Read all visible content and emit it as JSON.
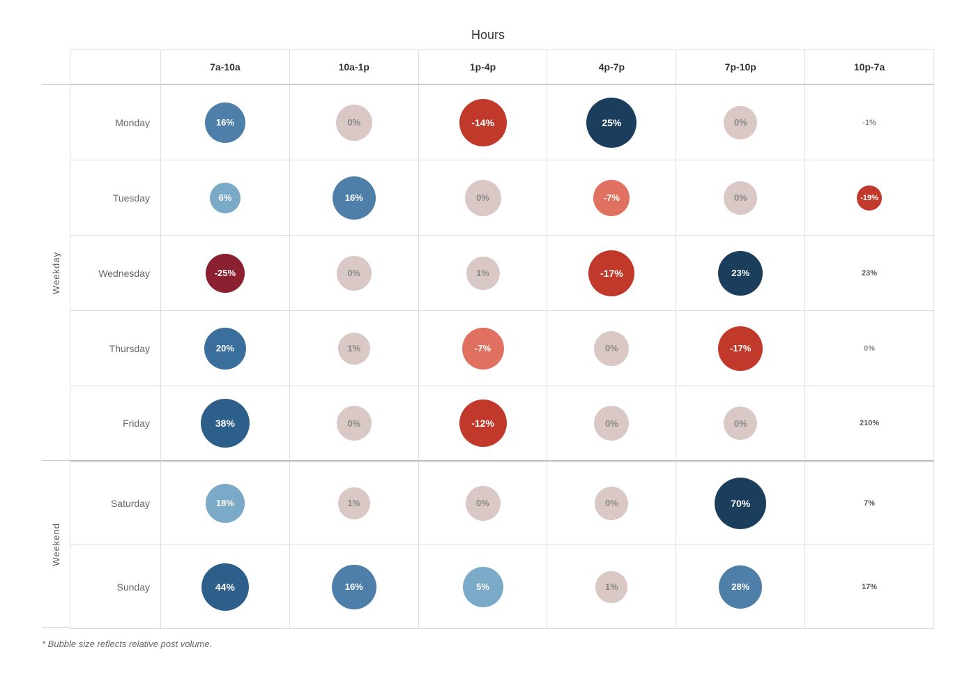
{
  "title": "Hours",
  "columns": [
    "",
    "7a-10a",
    "10a-1p",
    "1p-4p",
    "4p-7p",
    "7p-10p",
    "10p-7a"
  ],
  "groups": [
    {
      "name": "Weekday",
      "rows": [
        {
          "day": "Monday",
          "cells": [
            {
              "value": "16%",
              "size": 58,
              "color": "#4e7fa8",
              "textColor": "#fff"
            },
            {
              "value": "0%",
              "size": 52,
              "color": "#d9c8c5",
              "textColor": "#888"
            },
            {
              "value": "-14%",
              "size": 68,
              "color": "#c0392b",
              "textColor": "#fff"
            },
            {
              "value": "25%",
              "size": 72,
              "color": "#1a3e5c",
              "textColor": "#fff"
            },
            {
              "value": "0%",
              "size": 48,
              "color": "#d9c8c5",
              "textColor": "#888"
            },
            {
              "value": "-1%",
              "size": 30,
              "color": "transparent",
              "textColor": "#888"
            }
          ]
        },
        {
          "day": "Tuesday",
          "cells": [
            {
              "value": "6%",
              "size": 44,
              "color": "#7aaac8",
              "textColor": "#fff"
            },
            {
              "value": "16%",
              "size": 62,
              "color": "#4e7fa8",
              "textColor": "#fff"
            },
            {
              "value": "0%",
              "size": 52,
              "color": "#d9c8c5",
              "textColor": "#888"
            },
            {
              "value": "-7%",
              "size": 52,
              "color": "#e07060",
              "textColor": "#fff"
            },
            {
              "value": "0%",
              "size": 48,
              "color": "#d9c8c5",
              "textColor": "#888"
            },
            {
              "value": "-19%",
              "size": 36,
              "color": "#c0392b",
              "textColor": "#fff"
            }
          ]
        },
        {
          "day": "Wednesday",
          "cells": [
            {
              "value": "-25%",
              "size": 56,
              "color": "#8b2030",
              "textColor": "#fff"
            },
            {
              "value": "0%",
              "size": 50,
              "color": "#d9c8c5",
              "textColor": "#888"
            },
            {
              "value": "1%",
              "size": 48,
              "color": "#d9c8c5",
              "textColor": "#888"
            },
            {
              "value": "-17%",
              "size": 66,
              "color": "#c0392b",
              "textColor": "#fff"
            },
            {
              "value": "23%",
              "size": 64,
              "color": "#1a3e5c",
              "textColor": "#fff"
            },
            {
              "value": "23%",
              "size": 34,
              "color": "transparent",
              "textColor": "#555"
            }
          ]
        },
        {
          "day": "Thursday",
          "cells": [
            {
              "value": "20%",
              "size": 60,
              "color": "#3a6e9c",
              "textColor": "#fff"
            },
            {
              "value": "1%",
              "size": 46,
              "color": "#d9c8c5",
              "textColor": "#888"
            },
            {
              "value": "-7%",
              "size": 60,
              "color": "#e07060",
              "textColor": "#fff"
            },
            {
              "value": "0%",
              "size": 50,
              "color": "#d9c8c5",
              "textColor": "#888"
            },
            {
              "value": "-17%",
              "size": 64,
              "color": "#c0392b",
              "textColor": "#fff"
            },
            {
              "value": "0%",
              "size": 32,
              "color": "transparent",
              "textColor": "#888"
            }
          ]
        },
        {
          "day": "Friday",
          "cells": [
            {
              "value": "38%",
              "size": 70,
              "color": "#2c5f8a",
              "textColor": "#fff"
            },
            {
              "value": "0%",
              "size": 50,
              "color": "#d9c8c5",
              "textColor": "#888"
            },
            {
              "value": "-12%",
              "size": 68,
              "color": "#c0392b",
              "textColor": "#fff"
            },
            {
              "value": "0%",
              "size": 50,
              "color": "#d9c8c5",
              "textColor": "#888"
            },
            {
              "value": "0%",
              "size": 48,
              "color": "#d9c8c5",
              "textColor": "#888"
            },
            {
              "value": "210%",
              "size": 32,
              "color": "transparent",
              "textColor": "#555"
            }
          ]
        }
      ]
    },
    {
      "name": "Weekend",
      "rows": [
        {
          "day": "Saturday",
          "cells": [
            {
              "value": "18%",
              "size": 56,
              "color": "#7aaac8",
              "textColor": "#fff"
            },
            {
              "value": "1%",
              "size": 46,
              "color": "#d9c8c5",
              "textColor": "#888"
            },
            {
              "value": "0%",
              "size": 50,
              "color": "#d9c8c5",
              "textColor": "#888"
            },
            {
              "value": "0%",
              "size": 48,
              "color": "#d9c8c5",
              "textColor": "#888"
            },
            {
              "value": "70%",
              "size": 74,
              "color": "#1a3e5c",
              "textColor": "#fff"
            },
            {
              "value": "7%",
              "size": 34,
              "color": "transparent",
              "textColor": "#555"
            }
          ]
        },
        {
          "day": "Sunday",
          "cells": [
            {
              "value": "44%",
              "size": 68,
              "color": "#2c5f8a",
              "textColor": "#fff"
            },
            {
              "value": "16%",
              "size": 64,
              "color": "#4e7fa8",
              "textColor": "#fff"
            },
            {
              "value": "5%",
              "size": 58,
              "color": "#7aaac8",
              "textColor": "#fff"
            },
            {
              "value": "1%",
              "size": 46,
              "color": "#d9c8c5",
              "textColor": "#888"
            },
            {
              "value": "28%",
              "size": 62,
              "color": "#4e7fa8",
              "textColor": "#fff"
            },
            {
              "value": "17%",
              "size": 34,
              "color": "transparent",
              "textColor": "#555"
            }
          ]
        }
      ]
    }
  ],
  "footnote": "* Bubble size reflects relative post volume."
}
